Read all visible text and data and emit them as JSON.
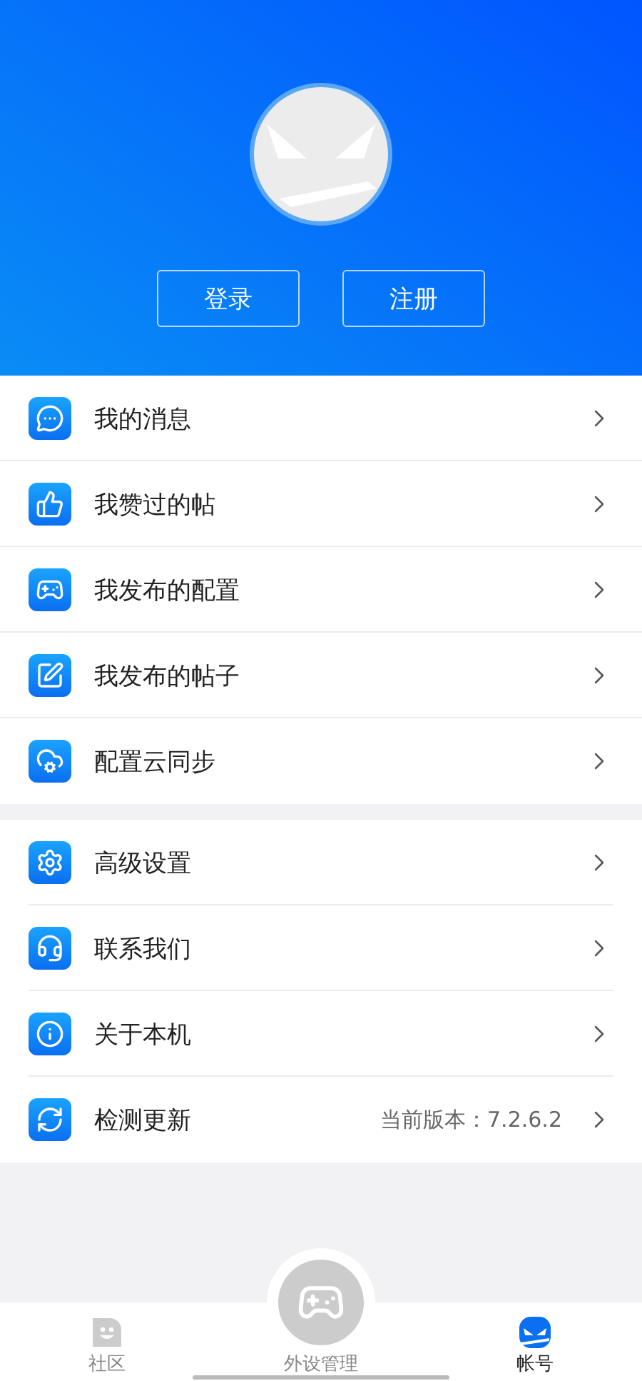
{
  "header": {
    "buttons": [
      "登录",
      "注册"
    ]
  },
  "menu_groups": [
    {
      "items": [
        {
          "label": "我的消息"
        },
        {
          "label": "我赞过的帖"
        },
        {
          "label": "我发布的配置"
        },
        {
          "label": "我发布的帖子"
        },
        {
          "label": "配置云同步"
        }
      ]
    },
    {
      "items": [
        {
          "label": "高级设置"
        },
        {
          "label": "联系我们"
        },
        {
          "label": "关于本机"
        },
        {
          "label": "检测更新",
          "detail": "当前版本：7.2.6.2"
        }
      ]
    }
  ],
  "tab_bar": [
    {
      "label": "社区",
      "selected": false
    },
    {
      "label": "外设管理",
      "selected": false
    },
    {
      "label": "帐号",
      "selected": true
    }
  ]
}
